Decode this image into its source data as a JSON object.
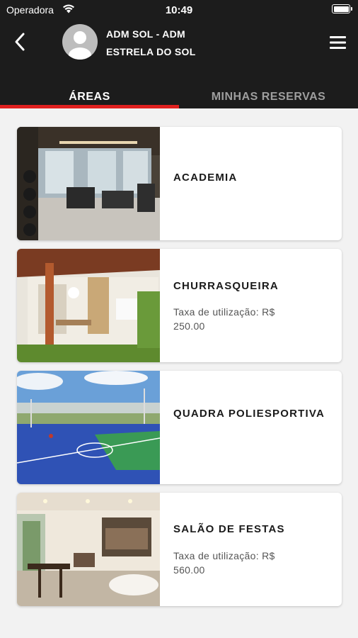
{
  "status_bar": {
    "carrier": "Operadora",
    "time": "10:49"
  },
  "header": {
    "user_name": "ADM SOL - ADM",
    "condo_name": "ESTRELA DO SOL"
  },
  "tabs": [
    {
      "label": "ÁREAS",
      "active": true
    },
    {
      "label": "MINHAS RESERVAS",
      "active": false
    }
  ],
  "areas": [
    {
      "title": "ACADEMIA",
      "fee": ""
    },
    {
      "title": "CHURRASQUEIRA",
      "fee": "Taxa de utilização: R$ 250.00"
    },
    {
      "title": "QUADRA POLIESPORTIVA",
      "fee": ""
    },
    {
      "title": "SALÃO DE FESTAS",
      "fee": "Taxa de utilização: R$ 560.00"
    }
  ],
  "icons": {
    "back": "back-arrow-icon",
    "menu": "hamburger-menu-icon",
    "avatar": "user-avatar-icon",
    "wifi": "wifi-icon",
    "battery": "battery-icon"
  },
  "colors": {
    "header_bg": "#1c1c1c",
    "accent": "#e0201f",
    "background": "#f2f2f2"
  }
}
